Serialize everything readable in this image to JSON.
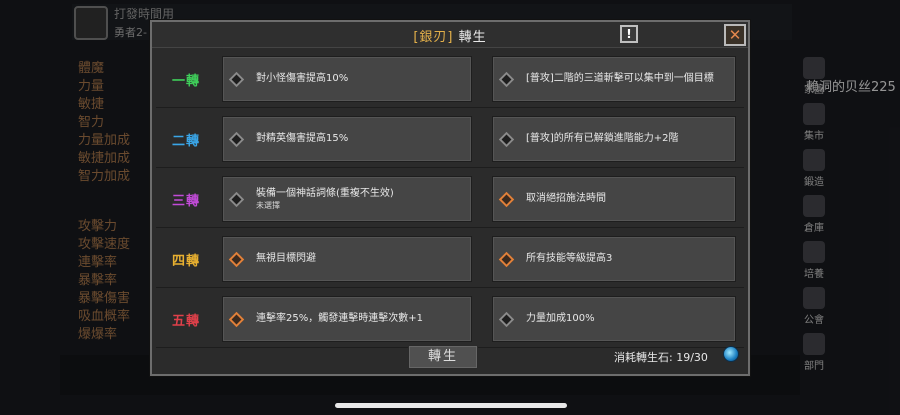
{
  "background": {
    "title": "打發時間用",
    "subtitle": "勇者2-",
    "stats_top": [
      "體魔",
      "力量",
      "敏捷",
      "智力",
      "力量加成",
      "敏捷加成",
      "智力加成"
    ],
    "stats_bottom": [
      "攻擊力",
      "攻擊速度",
      "連擊率",
      "暴擊率",
      "暴擊傷害",
      "吸血概率",
      "爆爆率"
    ],
    "player_name": "賴洞的贝丝225",
    "menu": [
      "家園",
      "集市",
      "鍛造",
      "倉庫",
      "培養",
      "公會",
      "部門"
    ]
  },
  "dialog": {
    "title_open": "[",
    "title_name": "銀刃",
    "title_close": "]",
    "title_suffix": "轉生",
    "info_label": "!",
    "close_label": "✕",
    "rows": [
      {
        "tier": "一轉",
        "color": "#3fcf5a",
        "left": {
          "text": "對小怪傷害提高10%",
          "sub": "",
          "active": false
        },
        "right": {
          "text": "[普攻]二階的三道斬擊可以集中到一個目標",
          "sub": "",
          "active": false
        }
      },
      {
        "tier": "二轉",
        "color": "#3aa6e8",
        "left": {
          "text": "對精英傷害提高15%",
          "sub": "",
          "active": false
        },
        "right": {
          "text": "[普攻]的所有已解鎖進階能力+2階",
          "sub": "",
          "active": false
        }
      },
      {
        "tier": "三轉",
        "color": "#c24bd8",
        "left": {
          "text": "裝備一個神話詞條(重複不生效)",
          "sub": "未選擇",
          "active": false
        },
        "right": {
          "text": "取消絕招施法時間",
          "sub": "",
          "active": true
        }
      },
      {
        "tier": "四轉",
        "color": "#e8b030",
        "left": {
          "text": "無視目標閃避",
          "sub": "",
          "active": true
        },
        "right": {
          "text": "所有技能等級提高3",
          "sub": "",
          "active": true
        }
      },
      {
        "tier": "五轉",
        "color": "#e0404a",
        "left": {
          "text": "連擊率25%，觸發連擊時連擊次數+1",
          "sub": "",
          "active": true
        },
        "right": {
          "text": "力量加成100%",
          "sub": "",
          "active": false
        }
      }
    ],
    "rebirth_button": "轉生",
    "cost_label": "消耗轉生石: 19/30"
  }
}
